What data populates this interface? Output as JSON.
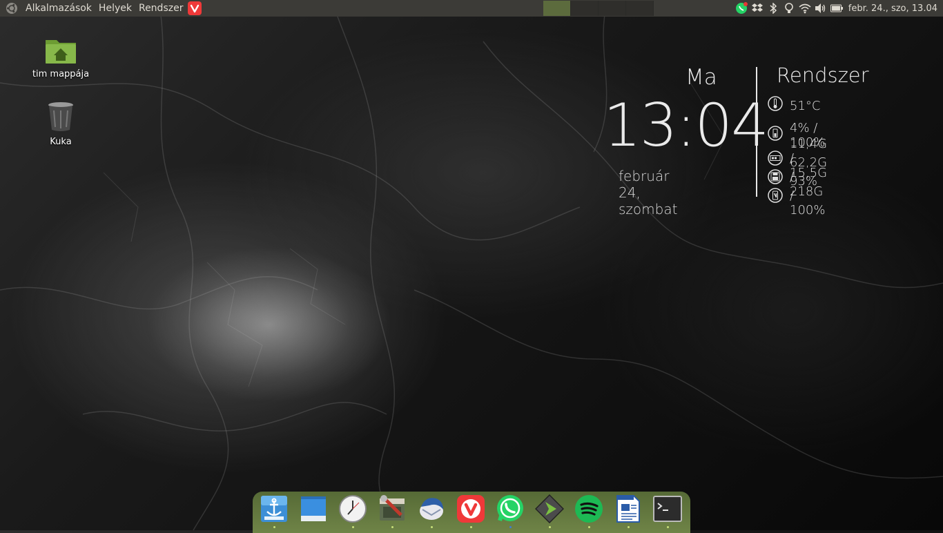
{
  "top_panel": {
    "ubuntu_icon": "ubuntu-logo-icon",
    "menu": [
      {
        "label": "Alkalmazások"
      },
      {
        "label": "Helyek"
      },
      {
        "label": "Rendszer"
      }
    ],
    "workspaces": [
      {
        "active": true
      },
      {
        "active": false
      },
      {
        "active": false
      },
      {
        "active": false
      }
    ],
    "tray_icons": [
      "whatsapp-icon",
      "dropbox-icon",
      "bluetooth-icon",
      "lightbulb-icon",
      "wifi-icon",
      "volume-icon",
      "battery-icon"
    ],
    "clock": "febr. 24., szo, 13.04"
  },
  "desktop": {
    "icons": [
      {
        "label": "tim mappája",
        "icon": "home-folder-icon"
      },
      {
        "label": "Kuka",
        "icon": "trash-icon"
      }
    ]
  },
  "conky": {
    "day": "Ma",
    "time": "13:04",
    "date": "február 24, szombat",
    "system_title": "Rendszer",
    "stats": [
      {
        "icon": "temperature-icon",
        "value": "51°C"
      },
      {
        "icon": "cpu-icon",
        "value": "4% / 100%"
      },
      {
        "icon": "memory-icon",
        "value": "11,4G / 15,5G"
      },
      {
        "icon": "disk-icon",
        "value": "62,2G / 218G"
      },
      {
        "icon": "battery-icon",
        "value": "93% / 100%"
      }
    ]
  },
  "dock": {
    "items": [
      {
        "name": "anchor-launcher-icon"
      },
      {
        "name": "desktop-window-icon"
      },
      {
        "name": "clock-app-icon"
      },
      {
        "name": "system-tools-icon"
      },
      {
        "name": "thunderbird-icon"
      },
      {
        "name": "vivaldi-icon"
      },
      {
        "name": "whatsapp-icon"
      },
      {
        "name": "media-player-icon"
      },
      {
        "name": "spotify-icon"
      },
      {
        "name": "writer-document-icon"
      },
      {
        "name": "terminal-icon"
      }
    ]
  },
  "colors": {
    "panel": "#3c3b37",
    "active_workspace": "#5c6b3d",
    "dock": "#627840",
    "vivaldi": "#ef3939",
    "whatsapp": "#25d366",
    "spotify": "#1db954"
  }
}
